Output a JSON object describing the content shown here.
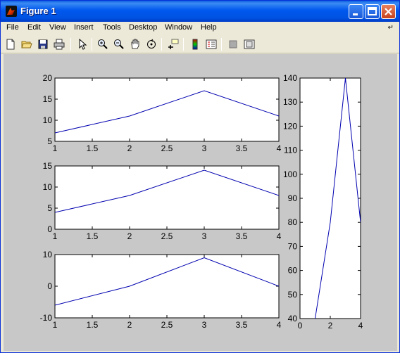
{
  "window": {
    "title": "Figure 1"
  },
  "menu": {
    "items": [
      "File",
      "Edit",
      "View",
      "Insert",
      "Tools",
      "Desktop",
      "Window",
      "Help"
    ]
  },
  "toolbar": {
    "tools": [
      "new-file-icon",
      "open-folder-icon",
      "save-icon",
      "print-icon",
      "pointer-icon",
      "zoom-in-icon",
      "zoom-out-icon",
      "pan-hand-icon",
      "rotate-3d-icon",
      "data-cursor-icon",
      "colorbar-icon",
      "legend-icon",
      "hide-plot-tools-icon",
      "show-plot-tools-icon"
    ]
  },
  "colors": {
    "line": "#0000b0",
    "axes_bg": "#ffffff",
    "figure_bg": "#c8c8c8",
    "titlebar": "#0058ee"
  },
  "chart_data": [
    {
      "type": "line",
      "x": [
        1,
        2,
        3,
        4
      ],
      "values": [
        7,
        11,
        17,
        11
      ],
      "xlim": [
        1,
        4
      ],
      "ylim": [
        5,
        20
      ],
      "xticks": [
        "1",
        "1.5",
        "2",
        "2.5",
        "3",
        "3.5",
        "4"
      ],
      "yticks": [
        "5",
        "10",
        "15",
        "20"
      ]
    },
    {
      "type": "line",
      "x": [
        1,
        2,
        3,
        4
      ],
      "values": [
        4,
        8,
        14,
        8
      ],
      "xlim": [
        1,
        4
      ],
      "ylim": [
        0,
        15
      ],
      "xticks": [
        "1",
        "1.5",
        "2",
        "2.5",
        "3",
        "3.5",
        "4"
      ],
      "yticks": [
        "0",
        "5",
        "10",
        "15"
      ]
    },
    {
      "type": "line",
      "x": [
        1,
        2,
        3,
        4
      ],
      "values": [
        -6,
        0,
        9,
        0
      ],
      "xlim": [
        1,
        4
      ],
      "ylim": [
        -10,
        10
      ],
      "xticks": [
        "1",
        "1.5",
        "2",
        "2.5",
        "3",
        "3.5",
        "4"
      ],
      "yticks": [
        "-10",
        "0",
        "10"
      ]
    },
    {
      "type": "line",
      "x": [
        1,
        2,
        3,
        4
      ],
      "values": [
        40,
        80,
        140,
        80
      ],
      "xlim": [
        0,
        4
      ],
      "ylim": [
        40,
        140
      ],
      "xticks": [
        "0",
        "2",
        "4"
      ],
      "yticks": [
        "40",
        "50",
        "60",
        "70",
        "80",
        "90",
        "100",
        "110",
        "120",
        "130",
        "140"
      ]
    }
  ]
}
